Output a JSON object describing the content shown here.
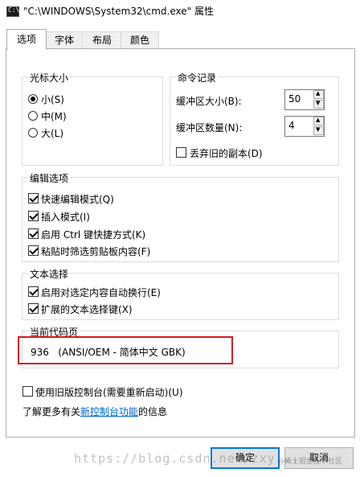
{
  "window": {
    "title": "\"C:\\WINDOWS\\System32\\cmd.exe\" 属性",
    "icon": "cmd-icon",
    "icon_glyph": "C:\\"
  },
  "tabs": [
    {
      "label": "选项",
      "active": true
    },
    {
      "label": "字体",
      "active": false
    },
    {
      "label": "布局",
      "active": false
    },
    {
      "label": "颜色",
      "active": false
    }
  ],
  "cursor_size": {
    "label": "光标大小",
    "options": [
      {
        "label": "小(S)",
        "checked": true
      },
      {
        "label": "中(M)",
        "checked": false
      },
      {
        "label": "大(L)",
        "checked": false
      }
    ]
  },
  "command_history": {
    "label": "命令记录",
    "buffer_size_label": "缓冲区大小(B):",
    "buffer_size_value": "50",
    "buffer_count_label": "缓冲区数量(N):",
    "buffer_count_value": "4",
    "discard_old_label": "丢弃旧的副本(D)",
    "discard_old_checked": false
  },
  "edit_options": {
    "label": "编辑选项",
    "items": [
      {
        "label": "快速编辑模式(Q)",
        "checked": true
      },
      {
        "label": "插入模式(I)",
        "checked": true
      },
      {
        "label": "启用 Ctrl 键快捷方式(K)",
        "checked": true
      },
      {
        "label": "粘贴时筛选剪贴板内容(F)",
        "checked": true
      }
    ]
  },
  "text_selection": {
    "label": "文本选择",
    "items": [
      {
        "label": "启用对选定内容自动换行(E)",
        "checked": true
      },
      {
        "label": "扩展的文本选择键(X)",
        "checked": true
      }
    ]
  },
  "code_page": {
    "label": "当前代码页",
    "value": "936   (ANSI/OEM - 简体中文 GBK)",
    "highlight_color": "#d21c1c"
  },
  "legacy_console": {
    "label": "使用旧版控制台(需要重新启动)(U)",
    "checked": false
  },
  "learn_more": {
    "prefix": "了解更多有关",
    "link": "新控制台功能",
    "suffix": "的信息"
  },
  "buttons": {
    "ok": "确定",
    "cancel": "取消"
  },
  "watermark": {
    "url": "https://blog.csdn.net/zxy...",
    "site": "@稀土掘金技术社区"
  },
  "colors": {
    "accent": "#0078d7",
    "link": "#0066cc"
  }
}
